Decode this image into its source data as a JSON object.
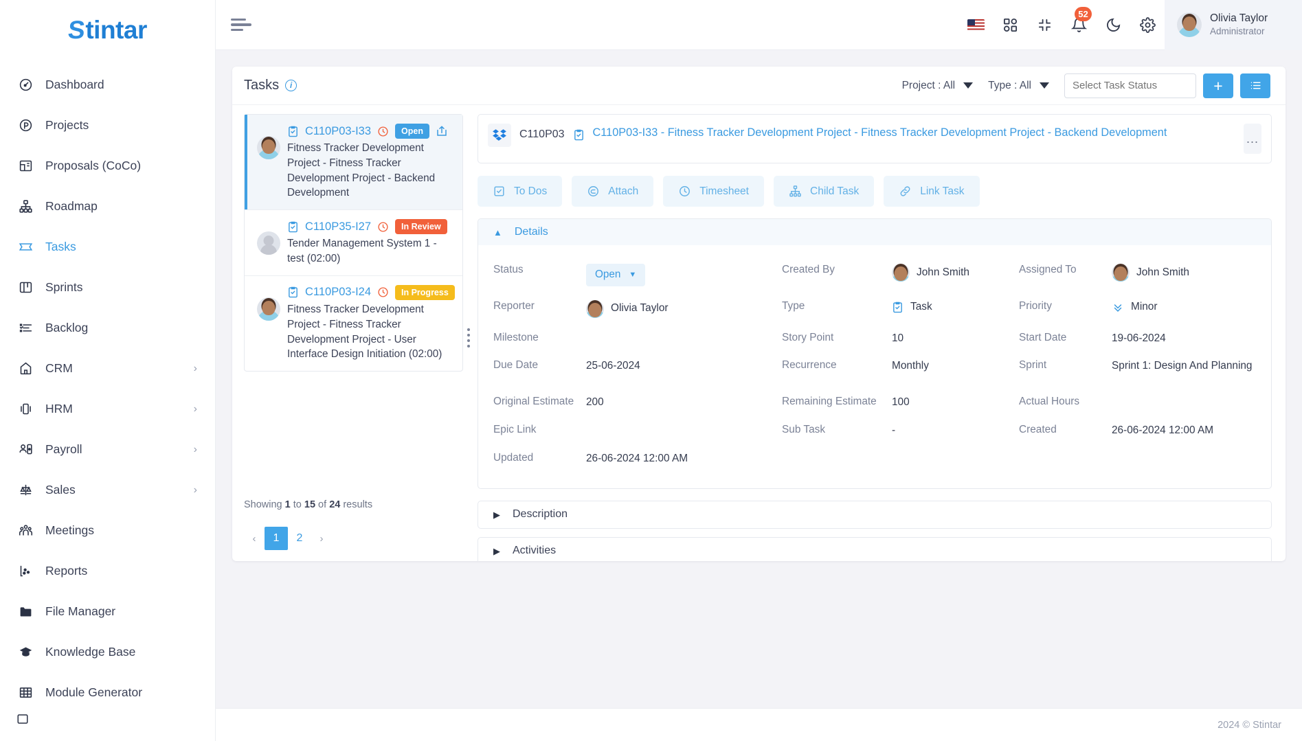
{
  "brand": {
    "name": "Stintar",
    "initial": "S",
    "rest": "tintar"
  },
  "sidebar": {
    "items": [
      {
        "label": "Dashboard",
        "icon": "gauge-icon",
        "active": false,
        "submenu": false
      },
      {
        "label": "Projects",
        "icon": "project-circle-icon",
        "active": false,
        "submenu": false
      },
      {
        "label": "Proposals (CoCo)",
        "icon": "proposal-icon",
        "active": false,
        "submenu": false
      },
      {
        "label": "Roadmap",
        "icon": "roadmap-icon",
        "active": false,
        "submenu": false
      },
      {
        "label": "Tasks",
        "icon": "tasks-icon",
        "active": true,
        "submenu": false
      },
      {
        "label": "Sprints",
        "icon": "sprints-icon",
        "active": false,
        "submenu": false
      },
      {
        "label": "Backlog",
        "icon": "backlog-icon",
        "active": false,
        "submenu": false
      },
      {
        "label": "CRM",
        "icon": "crm-icon",
        "active": false,
        "submenu": true
      },
      {
        "label": "HRM",
        "icon": "hrm-icon",
        "active": false,
        "submenu": true
      },
      {
        "label": "Payroll",
        "icon": "payroll-icon",
        "active": false,
        "submenu": true
      },
      {
        "label": "Sales",
        "icon": "sales-icon",
        "active": false,
        "submenu": true
      },
      {
        "label": "Meetings",
        "icon": "meetings-icon",
        "active": false,
        "submenu": false
      },
      {
        "label": "Reports",
        "icon": "reports-icon",
        "active": false,
        "submenu": false
      },
      {
        "label": "File Manager",
        "icon": "folder-icon",
        "active": false,
        "submenu": false
      },
      {
        "label": "Knowledge Base",
        "icon": "graduation-cap-icon",
        "active": false,
        "submenu": false
      },
      {
        "label": "Module Generator",
        "icon": "grid-table-icon",
        "active": false,
        "submenu": false
      }
    ]
  },
  "topbar": {
    "menu_toggle": "hamburger-icon",
    "language_flag": "us-flag-icon",
    "apps_icon": "apps-grid-icon",
    "collapse_icon": "collapse-screen-icon",
    "notifications_icon": "bell-icon",
    "notifications_count": "52",
    "dark_mode_icon": "moon-icon",
    "settings_icon": "gear-icon",
    "user": {
      "name": "Olivia Taylor",
      "role": "Administrator",
      "avatar": "user-avatar"
    }
  },
  "page": {
    "title": "Tasks",
    "info_icon": "info-icon",
    "filters": [
      {
        "label": "Project : All",
        "name": "project-filter"
      },
      {
        "label": "Type : All",
        "name": "type-filter"
      }
    ],
    "status_select": {
      "placeholder": "Select Task Status",
      "value": ""
    },
    "add_button": "+",
    "list_button": "list-view-icon"
  },
  "tasks": [
    {
      "id": "C110P03-I33",
      "status": "Open",
      "status_class": "open",
      "text": "Fitness Tracker Development Project - Fitness Tracker Development Project - Backend Development",
      "avatar": "photo",
      "selected": true,
      "has_share": true
    },
    {
      "id": "C110P35-I27",
      "status": "In Review",
      "status_class": "review",
      "text": "Tender Management System 1 - test (02:00)",
      "avatar": "blank",
      "selected": false,
      "has_share": false
    },
    {
      "id": "C110P03-I24",
      "status": "In Progress",
      "status_class": "progress",
      "text": "Fitness Tracker Development Project - Fitness Tracker Development Project - User Interface Design Initiation (02:00)",
      "avatar": "photo",
      "selected": false,
      "has_share": false
    }
  ],
  "pagination": {
    "showing_prefix": "Showing ",
    "from": "1",
    "mid1": " to ",
    "to": "15",
    "mid2": " of ",
    "total": "24",
    "suffix": " results",
    "prev": "‹",
    "next": "›",
    "pages": [
      "1",
      "2"
    ],
    "current": "1"
  },
  "detail": {
    "project_code": "C110P03",
    "project_icon": "dropbox-icon",
    "type_icon": "task-clipboard-icon",
    "title": "C110P03-I33 - Fitness Tracker Development Project - Fitness Tracker Development Project - Backend Development",
    "more_button": "...",
    "actions": [
      {
        "label": "To Dos",
        "icon": "checkbox-icon"
      },
      {
        "label": "Attach",
        "icon": "paperclip-icon"
      },
      {
        "label": "Timesheet",
        "icon": "clock-icon"
      },
      {
        "label": "Child Task",
        "icon": "hierarchy-icon"
      },
      {
        "label": "Link Task",
        "icon": "link-icon"
      }
    ],
    "details_section": {
      "label": "Details",
      "expanded": true,
      "chevron": "chevron-up-icon"
    },
    "fields": {
      "status_label": "Status",
      "status_value": "Open",
      "created_by_label": "Created By",
      "created_by_value": "John Smith",
      "assigned_to_label": "Assigned To",
      "assigned_to_value": "John Smith",
      "reporter_label": "Reporter",
      "reporter_value": "Olivia Taylor",
      "type_label": "Type",
      "type_value": "Task",
      "priority_label": "Priority",
      "priority_value": "Minor",
      "milestone_label": "Milestone",
      "milestone_value": "",
      "story_point_label": "Story Point",
      "story_point_value": "10",
      "start_date_label": "Start Date",
      "start_date_value": "19-06-2024",
      "due_date_label": "Due Date",
      "due_date_value": "25-06-2024",
      "recurrence_label": "Recurrence",
      "recurrence_value": "Monthly",
      "sprint_label": "Sprint",
      "sprint_value": "Sprint 1: Design And Planning",
      "original_estimate_label": "Original Estimate",
      "original_estimate_value": "200",
      "remaining_estimate_label": "Remaining Estimate",
      "remaining_estimate_value": "100",
      "actual_hours_label": "Actual Hours",
      "actual_hours_value": "",
      "epic_link_label": "Epic Link",
      "epic_link_value": "",
      "sub_task_label": "Sub Task",
      "sub_task_value": "-",
      "created_label": "Created",
      "created_value": "26-06-2024 12:00 AM",
      "updated_label": "Updated",
      "updated_value": "26-06-2024 12:00 AM"
    },
    "description_section": {
      "label": "Description",
      "chevron": "chevron-right-icon"
    },
    "activities_section": {
      "label": "Activities",
      "chevron": "chevron-right-icon"
    }
  },
  "footer": {
    "text": "2024 © Stintar"
  },
  "colors": {
    "accent": "#41a5e8",
    "open": "#3fa0e3",
    "review": "#f1603a",
    "progress": "#f5bc1c",
    "link": "#3a9ae0",
    "notification": "#f1603a"
  }
}
